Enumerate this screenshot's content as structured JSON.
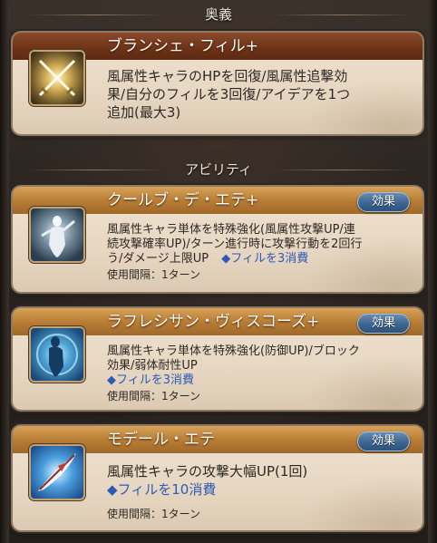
{
  "sections": {
    "ougi_heading": "奥義",
    "ability_heading": "アビリティ"
  },
  "ougi": {
    "name": "ブランシェ・フィル+",
    "desc_lines": [
      "風属性キャラのHPを回復/風属性追撃効",
      "果/自分のフィルを3回復/アイデアを1つ",
      "追加(最大3)"
    ],
    "icon": "crossed-swords-icon"
  },
  "abilities": [
    {
      "name": "クールブ・デ・エテ+",
      "button": "効果",
      "desc_lines": [
        "風属性キャラ単体を特殊強化(風属性攻撃UP/連",
        "続攻撃確率UP)/ターン進行時に攻撃行動を2回行",
        "う/ダメージ上限UP"
      ],
      "fil": "◆フィルを3消費",
      "usage": "使用間隔：1ターン",
      "icon": "dancer-silhouette-icon"
    },
    {
      "name": "ラフレシサン・ヴィスコーズ+",
      "button": "効果",
      "desc_lines": [
        "風属性キャラ単体を特殊強化(防御UP)/ブロック",
        "効果/弱体耐性UP"
      ],
      "fil": "◆フィルを3消費",
      "usage": "使用間隔：1ターン",
      "icon": "blue-figure-icon"
    },
    {
      "name": "モデール・エテ",
      "button": "効果",
      "desc_lines": [
        "風属性キャラの攻撃大幅UP(1回)"
      ],
      "fil": "◆フィルを10消費",
      "usage": "使用間隔：1ターン",
      "icon": "quill-feather-icon"
    }
  ]
}
